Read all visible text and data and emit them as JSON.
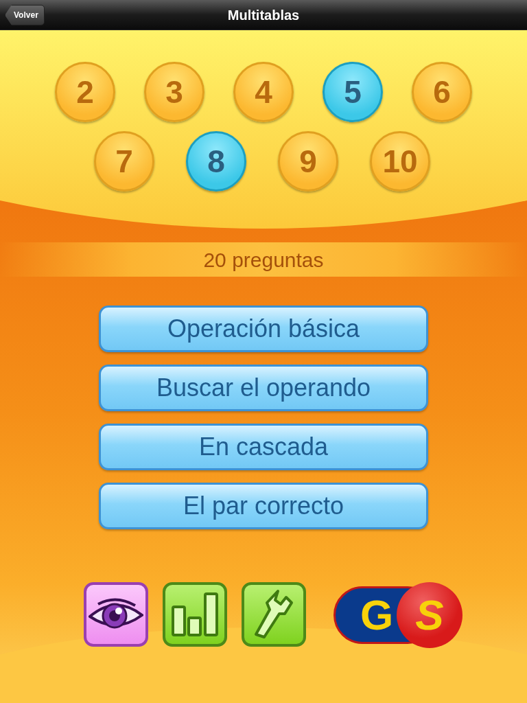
{
  "nav_bar": {
    "back_button": "Volver",
    "title": "Multitablas"
  },
  "tables": [
    {
      "label": "2",
      "selected": false
    },
    {
      "label": "3",
      "selected": false
    },
    {
      "label": "4",
      "selected": false
    },
    {
      "label": "5",
      "selected": true
    },
    {
      "label": "6",
      "selected": false
    },
    {
      "label": "7",
      "selected": false
    },
    {
      "label": "8",
      "selected": true
    },
    {
      "label": "9",
      "selected": false
    },
    {
      "label": "10",
      "selected": false
    }
  ],
  "question_count": "20 preguntas",
  "modes": [
    "Operación básica",
    "Buscar el operando",
    "En cascada",
    "El par correcto"
  ],
  "toolbar": [
    {
      "kind": "eye"
    },
    {
      "kind": "stats"
    },
    {
      "kind": "settings"
    }
  ],
  "logo": {
    "letters": [
      "G",
      "S"
    ]
  }
}
